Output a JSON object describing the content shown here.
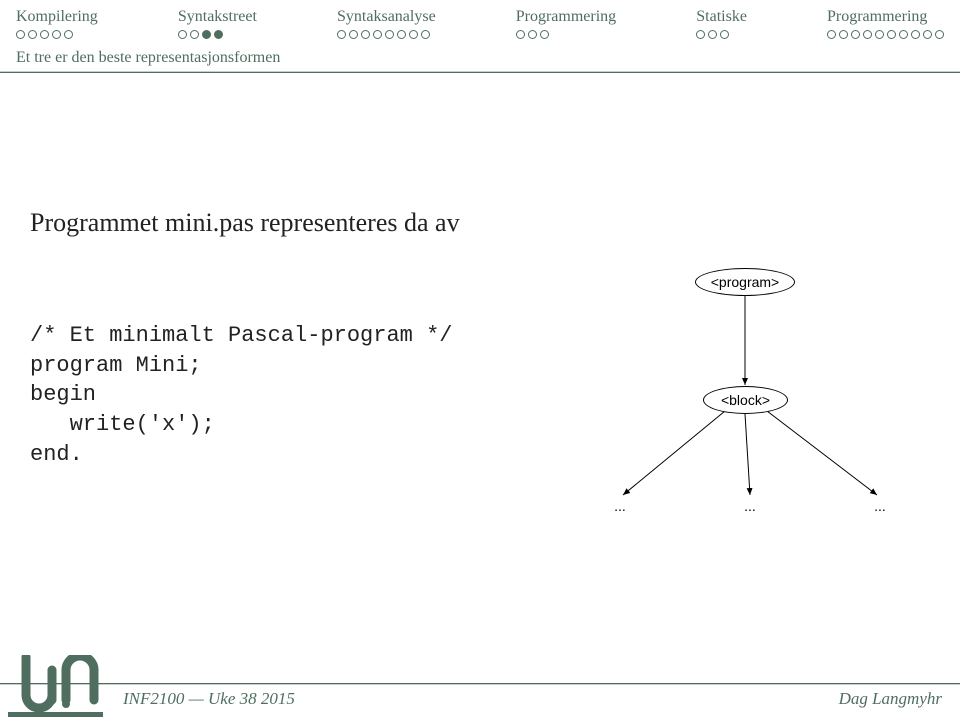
{
  "nav": [
    {
      "label": "Kompilering",
      "total": 5,
      "filled": []
    },
    {
      "label": "Syntakstreet",
      "total": 4,
      "filled": [
        2,
        3
      ]
    },
    {
      "label": "Syntaksanalyse",
      "total": 8,
      "filled": []
    },
    {
      "label": "Programmering",
      "total": 3,
      "filled": []
    },
    {
      "label": "Statiske",
      "total": 3,
      "filled": []
    },
    {
      "label": "Programmering",
      "total": 10,
      "filled": []
    }
  ],
  "subtitle": "Et tre er den beste representasjonsformen",
  "heading": "Programmet mini.pas representeres da av",
  "code": "/* Et minimalt Pascal-program */\nprogram Mini;\nbegin\n   write('x');\nend.",
  "diagram": {
    "root": "<program>",
    "child": "<block>",
    "leaf": "..."
  },
  "footer": {
    "left": "INF2100 — Uke 38 2015",
    "right": "Dag Langmyhr"
  }
}
